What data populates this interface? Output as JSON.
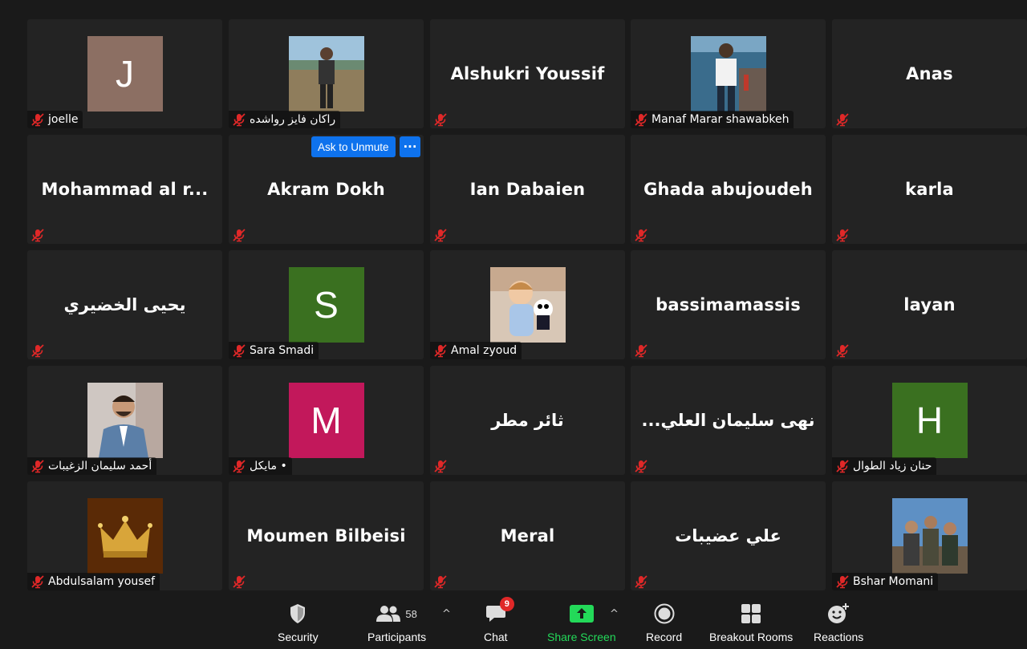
{
  "participants": [
    {
      "display": "letter",
      "letter": "J",
      "color": "#8c6f63",
      "name": "joelle"
    },
    {
      "display": "photo",
      "photo": "beach",
      "name": "راكان فايز رواشده"
    },
    {
      "display": "name",
      "name": "Alshukri Youssif"
    },
    {
      "display": "photo",
      "photo": "sea",
      "name": "Manaf Marar shawabkeh"
    },
    {
      "display": "name",
      "name": "Anas"
    },
    {
      "display": "name",
      "name": "Mohammad al r..."
    },
    {
      "display": "name",
      "name": "Akram Dokh"
    },
    {
      "display": "name",
      "name": "Ian Dabaien"
    },
    {
      "display": "name",
      "name": "Ghada abujoudeh"
    },
    {
      "display": "name",
      "name": "karla"
    },
    {
      "display": "name",
      "name": "يحيى الخضيري"
    },
    {
      "display": "letter",
      "letter": "S",
      "color": "#3a7020",
      "name": "Sara Smadi"
    },
    {
      "display": "photo",
      "photo": "child",
      "name": "Amal zyoud"
    },
    {
      "display": "name",
      "name": "bassimamassis"
    },
    {
      "display": "name",
      "name": "layan"
    },
    {
      "display": "photo",
      "photo": "man",
      "name": "أحمد سليمان الزغيبات"
    },
    {
      "display": "letter",
      "letter": "M",
      "color": "#c2185b",
      "name": "مايكل •"
    },
    {
      "display": "name",
      "name": "ثائر مطر"
    },
    {
      "display": "name",
      "name": "...نهى سليمان العلي"
    },
    {
      "display": "letter",
      "letter": "H",
      "color": "#3a7020",
      "name": "حنان زياد الطوال"
    },
    {
      "display": "photo",
      "photo": "crown",
      "name": "Abdulsalam yousef"
    },
    {
      "display": "name",
      "name": "Moumen Bilbeisi"
    },
    {
      "display": "name",
      "name": "Meral"
    },
    {
      "display": "name",
      "name": "علي عضيبات"
    },
    {
      "display": "photo",
      "photo": "group",
      "name": "Bshar Momani"
    }
  ],
  "hover_actions": {
    "ask_unmute": "Ask to Unmute",
    "more": "···"
  },
  "toolbar": {
    "security": "Security",
    "participants": "Participants",
    "participants_count": "58",
    "chat": "Chat",
    "chat_badge": "9",
    "share_screen": "Share Screen",
    "record": "Record",
    "breakout_rooms": "Breakout Rooms",
    "reactions": "Reactions"
  },
  "colors": {
    "share_green": "#23d959",
    "ask_blue": "#0e72ed",
    "muted_red": "#e02828"
  }
}
